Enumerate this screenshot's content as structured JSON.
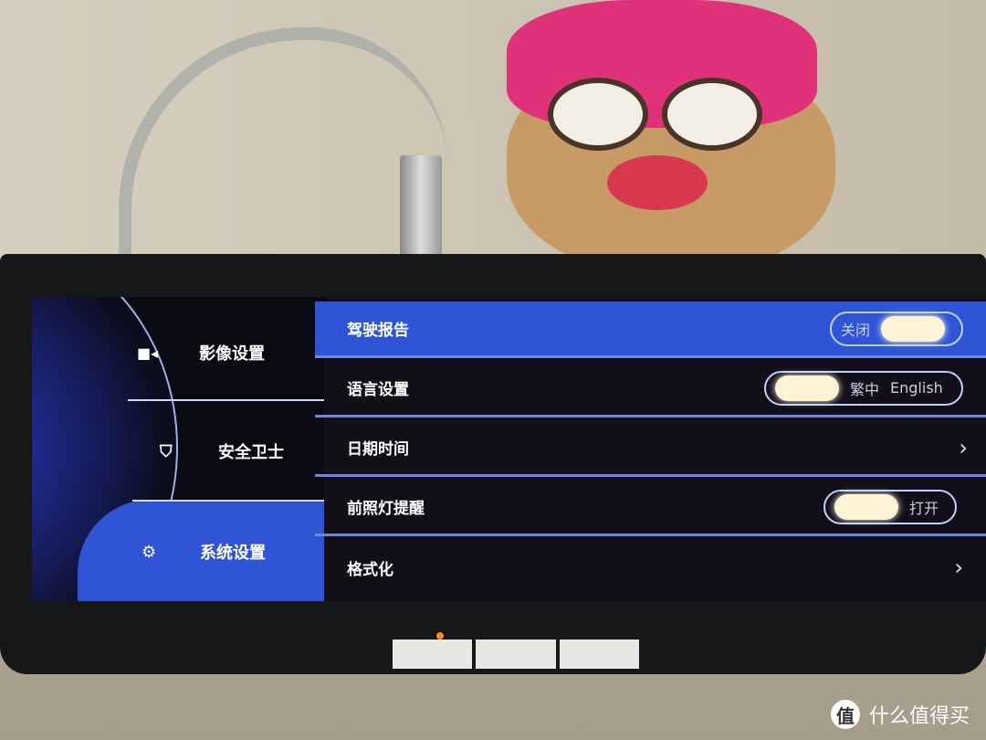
{
  "sidebar": {
    "items": [
      {
        "label": "影像设置",
        "icon": "video-camera-icon"
      },
      {
        "label": "安全卫士",
        "icon": "shield-check-icon"
      },
      {
        "label": "系统设置",
        "icon": "gear-icon",
        "selected": true
      }
    ]
  },
  "settings": {
    "driving_report": {
      "label": "驾驶报告",
      "toggle_label": "关闭",
      "state": "off"
    },
    "language": {
      "label": "语言设置",
      "option1": "繁中",
      "option2": "English"
    },
    "datetime": {
      "label": "日期时间",
      "icon": "chevron-right-icon"
    },
    "headlight": {
      "label": "前照灯提醒",
      "toggle_label": "打开",
      "state": "on"
    },
    "format": {
      "label": "格式化",
      "icon": "chevron-right-icon"
    }
  },
  "watermark": {
    "logo": "值",
    "text": "什么值得买"
  },
  "colors": {
    "accent": "#2f55d6",
    "knob": "#fff3d6"
  }
}
